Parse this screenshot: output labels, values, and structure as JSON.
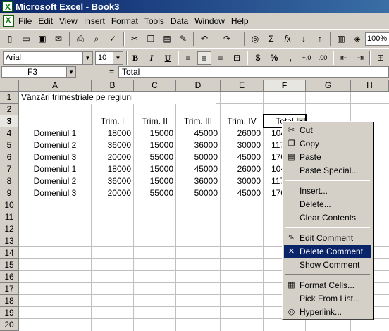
{
  "window": {
    "title": "Microsoft Excel - Book3"
  },
  "menu": [
    "File",
    "Edit",
    "View",
    "Insert",
    "Format",
    "Tools",
    "Data",
    "Window",
    "Help"
  ],
  "toolbar": {
    "font_name": "Arial",
    "font_size": "10",
    "bold": "B",
    "italic": "I",
    "underline": "U",
    "percent": "%",
    "comma": ",",
    "zoom": "100%",
    "icons": [
      "new-icon",
      "open-icon",
      "save-icon",
      "email-icon",
      "print-icon",
      "print-preview-icon",
      "spelling-icon",
      "cut-icon",
      "copy-icon",
      "paste-icon",
      "format-painter-icon",
      "undo-icon",
      "redo-icon",
      "hyperlink-icon",
      "autosum-icon",
      "function-icon",
      "sort-asc-icon",
      "sort-desc-icon",
      "chart-wizard-icon",
      "drawing-icon"
    ]
  },
  "formula_bar": {
    "name_box": "F3",
    "equals": "=",
    "content": "Total"
  },
  "columns": [
    "A",
    "B",
    "C",
    "D",
    "E",
    "F",
    "G",
    "H"
  ],
  "rows": [
    "1",
    "2",
    "3",
    "4",
    "5",
    "6",
    "7",
    "8",
    "9",
    "10",
    "11",
    "12",
    "13",
    "14",
    "15",
    "16",
    "17",
    "18",
    "19",
    "20"
  ],
  "sheet": {
    "title": "Vânzări trimestriale pe regiuni",
    "headers": [
      "Trim. I",
      "Trim. II",
      "Trim. III",
      "Trim. IV",
      "Total"
    ],
    "data": [
      [
        "Domeniul 1",
        "18000",
        "15000",
        "45000",
        "26000",
        "104"
      ],
      [
        "Domeniul 2",
        "36000",
        "15000",
        "36000",
        "30000",
        "117"
      ],
      [
        "Domeniul 3",
        "20000",
        "55000",
        "50000",
        "45000",
        "170"
      ],
      [
        "Domeniul 1",
        "18000",
        "15000",
        "45000",
        "26000",
        "104"
      ],
      [
        "Domeniul 2",
        "36000",
        "15000",
        "36000",
        "30000",
        "117"
      ],
      [
        "Domeniul 3",
        "20000",
        "55000",
        "50000",
        "45000",
        "170"
      ]
    ]
  },
  "context_menu": {
    "items": [
      {
        "label": "Cut",
        "icon": "cut-icon"
      },
      {
        "label": "Copy",
        "icon": "copy-icon"
      },
      {
        "label": "Paste",
        "icon": "paste-icon"
      },
      {
        "label": "Paste Special...",
        "icon": ""
      },
      {
        "label": "Insert...",
        "icon": ""
      },
      {
        "label": "Delete...",
        "icon": ""
      },
      {
        "label": "Clear Contents",
        "icon": ""
      },
      {
        "label": "Edit Comment",
        "icon": "edit-comment-icon"
      },
      {
        "label": "Delete Comment",
        "icon": "delete-comment-icon",
        "highlighted": true
      },
      {
        "label": "Show Comment",
        "icon": ""
      },
      {
        "label": "Format Cells...",
        "icon": "format-cells-icon"
      },
      {
        "label": "Pick From List...",
        "icon": ""
      },
      {
        "label": "Hyperlink...",
        "icon": "hyperlink-icon"
      }
    ]
  },
  "colors": {
    "title_bar": "#0a246a",
    "menu_highlight": "#0a246a",
    "chrome": "#d4d0c8"
  }
}
